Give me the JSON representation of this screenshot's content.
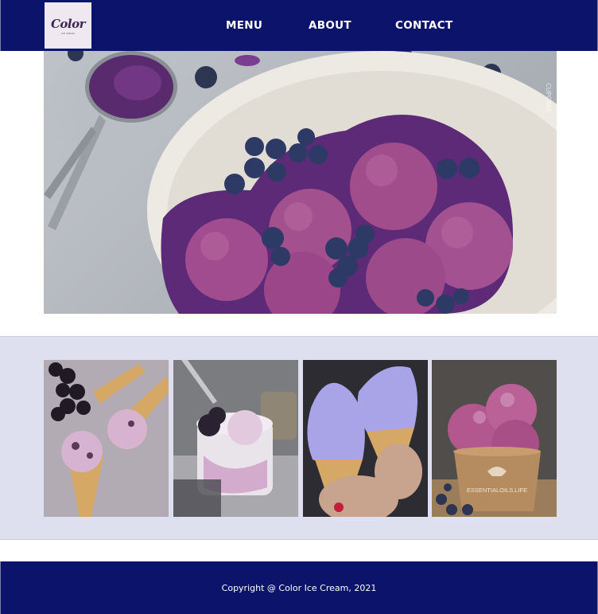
{
  "colors": {
    "header_bg": "#0c136a",
    "gallery_bg": "#dfe0ef",
    "footer_bg": "#0c136a"
  },
  "brand": {
    "logo_text": "Color",
    "logo_subtext": "ICE CREAM"
  },
  "nav": {
    "items": [
      {
        "label": "MENU"
      },
      {
        "label": "ABOUT"
      },
      {
        "label": "CONTACT"
      }
    ]
  },
  "hero": {
    "image": "purple-blueberry-ice-cream-bowl",
    "watermark": "CUPCAKE"
  },
  "gallery": {
    "images": [
      "blackberry-ice-cream-cones",
      "ice-cream-jar-with-blackberry",
      "lavender-soft-serve-cones",
      "berry-ice-cream-cup"
    ],
    "cup_label": "ESSENTIALOILS.LIFE"
  },
  "footer": {
    "copyright": "Copyright @ Color Ice Cream, 2021"
  }
}
